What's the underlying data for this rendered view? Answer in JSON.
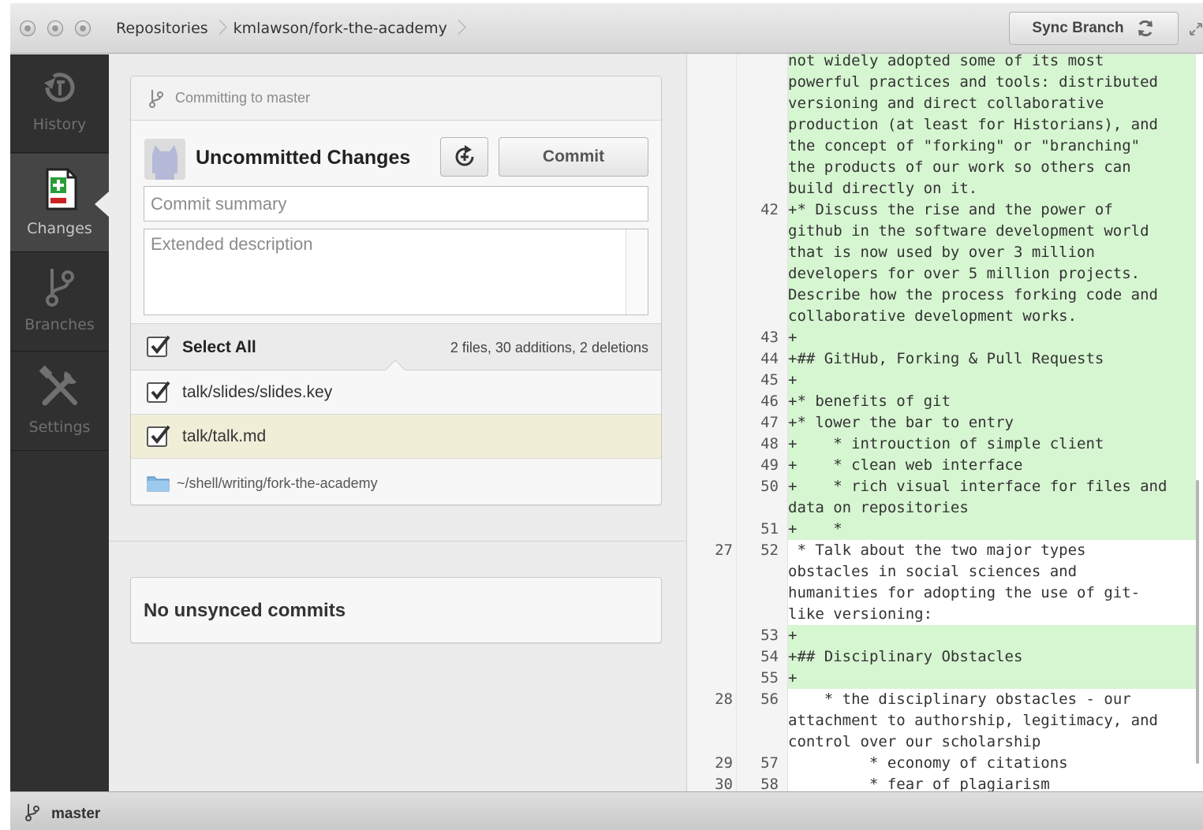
{
  "titlebar": {
    "breadcrumbs": [
      "Repositories",
      "kmlawson/fork-the-academy"
    ],
    "sync_label": "Sync Branch"
  },
  "sidebar": {
    "items": [
      {
        "label": "History",
        "icon": "history-icon"
      },
      {
        "label": "Changes",
        "icon": "changes-icon",
        "active": true
      },
      {
        "label": "Branches",
        "icon": "branch-icon"
      },
      {
        "label": "Settings",
        "icon": "settings-icon"
      }
    ]
  },
  "commit_panel": {
    "committing_to": "Committing to master",
    "title": "Uncommitted Changes",
    "commit_label": "Commit",
    "summary_placeholder": "Commit summary",
    "description_placeholder": "Extended description",
    "select_all_label": "Select All",
    "stats": "2 files, 30 additions, 2 deletions",
    "files": [
      {
        "name": "talk/slides/slides.key",
        "checked": true,
        "selected": false
      },
      {
        "name": "talk/talk.md",
        "checked": true,
        "selected": true
      }
    ],
    "repo_path": "~/shell/writing/fork-the-academy"
  },
  "unsynced": {
    "label": "No unsynced commits"
  },
  "diff": {
    "lines": [
      {
        "old": "",
        "new": "",
        "type": "add",
        "text": "not widely adopted some of its most"
      },
      {
        "old": "",
        "new": "",
        "type": "add",
        "text": "powerful practices and tools: distributed"
      },
      {
        "old": "",
        "new": "",
        "type": "add",
        "text": "versioning and direct collaborative"
      },
      {
        "old": "",
        "new": "",
        "type": "add",
        "text": "production (at least for Historians), and"
      },
      {
        "old": "",
        "new": "",
        "type": "add",
        "text": "the concept of \"forking\" or \"branching\""
      },
      {
        "old": "",
        "new": "",
        "type": "add",
        "text": "the products of our work so others can"
      },
      {
        "old": "",
        "new": "",
        "type": "add",
        "text": "build directly on it."
      },
      {
        "old": "",
        "new": "42",
        "type": "add",
        "text": "+* Discuss the rise and the power of"
      },
      {
        "old": "",
        "new": "",
        "type": "add",
        "text": "github in the software development world"
      },
      {
        "old": "",
        "new": "",
        "type": "add",
        "text": "that is now used by over 3 million"
      },
      {
        "old": "",
        "new": "",
        "type": "add",
        "text": "developers for over 5 million projects."
      },
      {
        "old": "",
        "new": "",
        "type": "add",
        "text": "Describe how the process forking code and"
      },
      {
        "old": "",
        "new": "",
        "type": "add",
        "text": "collaborative development works."
      },
      {
        "old": "",
        "new": "43",
        "type": "add",
        "text": "+"
      },
      {
        "old": "",
        "new": "44",
        "type": "add",
        "text": "+## GitHub, Forking & Pull Requests"
      },
      {
        "old": "",
        "new": "45",
        "type": "add",
        "text": "+"
      },
      {
        "old": "",
        "new": "46",
        "type": "add",
        "text": "+* benefits of git"
      },
      {
        "old": "",
        "new": "47",
        "type": "add",
        "text": "+* lower the bar to entry"
      },
      {
        "old": "",
        "new": "48",
        "type": "add",
        "text": "+    * introuction of simple client"
      },
      {
        "old": "",
        "new": "49",
        "type": "add",
        "text": "+    * clean web interface"
      },
      {
        "old": "",
        "new": "50",
        "type": "add",
        "text": "+    * rich visual interface for files and"
      },
      {
        "old": "",
        "new": "",
        "type": "add",
        "text": "data on repositories"
      },
      {
        "old": "",
        "new": "51",
        "type": "add",
        "text": "+    *"
      },
      {
        "old": "27",
        "new": "52",
        "type": "ctx",
        "text": " * Talk about the two major types"
      },
      {
        "old": "",
        "new": "",
        "type": "ctx",
        "text": "obstacles in social sciences and"
      },
      {
        "old": "",
        "new": "",
        "type": "ctx",
        "text": "humanities for adopting the use of git-"
      },
      {
        "old": "",
        "new": "",
        "type": "ctx",
        "text": "like versioning:"
      },
      {
        "old": "",
        "new": "53",
        "type": "add",
        "text": "+"
      },
      {
        "old": "",
        "new": "54",
        "type": "add",
        "text": "+## Disciplinary Obstacles"
      },
      {
        "old": "",
        "new": "55",
        "type": "add",
        "text": "+"
      },
      {
        "old": "28",
        "new": "56",
        "type": "ctx",
        "text": "    * the disciplinary obstacles - our"
      },
      {
        "old": "",
        "new": "",
        "type": "ctx",
        "text": "attachment to authorship, legitimacy, and"
      },
      {
        "old": "",
        "new": "",
        "type": "ctx",
        "text": "control over our scholarship"
      },
      {
        "old": "29",
        "new": "57",
        "type": "ctx",
        "text": "         * economy of citations"
      },
      {
        "old": "30",
        "new": "58",
        "type": "ctx",
        "text": "         * fear of plagiarism"
      }
    ]
  },
  "statusbar": {
    "branch": "master"
  }
}
